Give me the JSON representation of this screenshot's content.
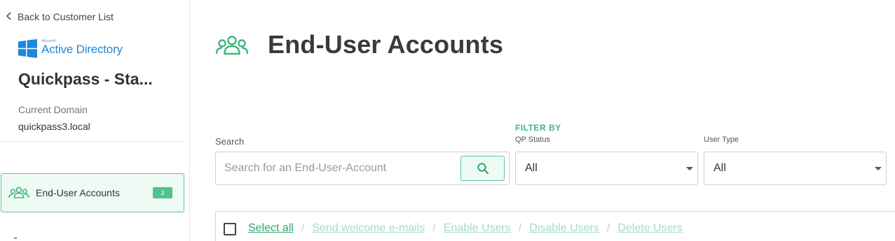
{
  "sidebar": {
    "back_link": "Back to Customer List",
    "logo": {
      "maker": "Microsoft",
      "product": "Active Directory"
    },
    "org_name": "Quickpass - Sta...",
    "domain_label": "Current Domain",
    "domain_value": "quickpass3.local",
    "nav": [
      {
        "label": "End-User Accounts",
        "badge": "3",
        "icon": "users-group-icon",
        "active": true
      }
    ]
  },
  "main": {
    "title": "End-User Accounts",
    "title_icon": "users-group-icon",
    "search": {
      "label": "Search",
      "placeholder": "Search for an End-User-Account",
      "value": ""
    },
    "filter_by": "FILTER BY",
    "filters": [
      {
        "label": "QP Status",
        "value": "All"
      },
      {
        "label": "User Type",
        "value": "All"
      }
    ],
    "actions": {
      "select_all": "Select all",
      "send_welcome": "Send welcome e-mails",
      "enable": "Enable Users",
      "disable": "Disable Users",
      "delete": "Delete Users",
      "separator": "/"
    }
  },
  "colors": {
    "accent": "#3fb57f",
    "accent_light": "#eefaf4",
    "muted_link": "#a6dcc2",
    "ad_blue": "#1e88d9"
  }
}
